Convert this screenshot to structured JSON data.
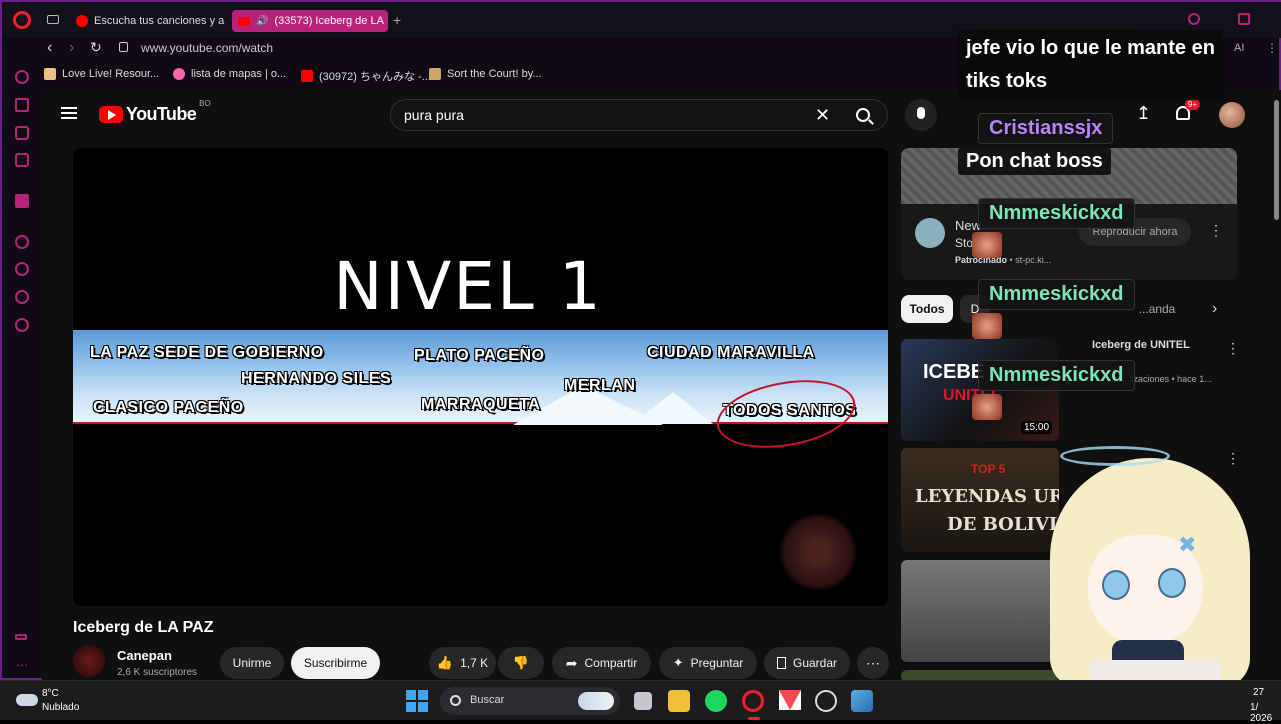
{
  "browser": {
    "tabs": [
      {
        "label": "Escucha tus canciones y a"
      },
      {
        "label": "(33573) Iceberg de LA"
      }
    ],
    "new_tab": "+",
    "url": "www.youtube.com/watch",
    "bookmarks": [
      {
        "label": "Love Live! Resour..."
      },
      {
        "label": "lista de mapas | o..."
      },
      {
        "label": "(30972) ちゃんみな -..."
      },
      {
        "label": "Sort the Court! by..."
      }
    ],
    "ai_label": "AI"
  },
  "youtube": {
    "logo": "YouTube",
    "country": "BO",
    "search_value": "pura pura",
    "notifications_badge": "9+",
    "video_overlay": {
      "title_text": "NIVEL 1",
      "labels": [
        "LA PAZ SEDE DE GOBIERNO",
        "PLATO PACEÑO",
        "CIUDAD MARAVILLA",
        "HERNANDO SILES",
        "MERLAN",
        "CLASICO PACEÑO",
        "MARRAQUETA",
        "TODOS SANTOS"
      ]
    },
    "video_title": "Iceberg de LA PAZ",
    "channel": {
      "name": "Canepan",
      "subs": "2,6 K suscriptores"
    },
    "buttons": {
      "join": "Unirme",
      "subscribe": "Suscribirme",
      "likes": "1,7 K",
      "share": "Compartir",
      "ask": "Preguntar",
      "save": "Guardar"
    },
    "ad": {
      "title": "New",
      "subtitle": "Sto... ot",
      "sponsored": "Patrocinado",
      "domain": "st-pc.ki...",
      "cta": "Reproducir ahora"
    },
    "chips": [
      {
        "label": "Todos"
      },
      {
        "label": "D"
      },
      {
        "label": "...anda"
      }
    ],
    "recs": [
      {
        "title": "Iceberg de UNITEL",
        "meta": "...lizaciones • hace 1...",
        "duration": "15:00",
        "thumb_text": "ICEBE",
        "thumb_sub": "UNITEL"
      },
      {
        "thumb_top": "TOP 5",
        "thumb_text": "LEYENDAS URBAN",
        "thumb_sub": "DE BOLIVIA"
      }
    ]
  },
  "chat": {
    "messages": [
      {
        "text_line1": "jefe vio lo que le mante en",
        "text_line2": "tiks toks"
      },
      {
        "name": "Cristianssjx",
        "name_color": "#b886f5",
        "text": "Pon chat boss"
      },
      {
        "name": "Nmmeskickxd",
        "name_color": "#7ee3b8"
      },
      {
        "name": "Nmmeskickxd",
        "name_color": "#7ee3b8"
      },
      {
        "name": "Nmmeskickxd",
        "name_color": "#7ee3b8"
      }
    ]
  },
  "taskbar": {
    "weather_temp": "8°C",
    "weather_desc": "Nublado",
    "search_label": "Buscar",
    "time": "27",
    "date": "1/ 2026"
  },
  "colors": {
    "opera_red": "#ff1b2d",
    "youtube_red": "#ff0000",
    "accent_pink": "#b7237a",
    "frame_purple": "#6b1f8a"
  }
}
